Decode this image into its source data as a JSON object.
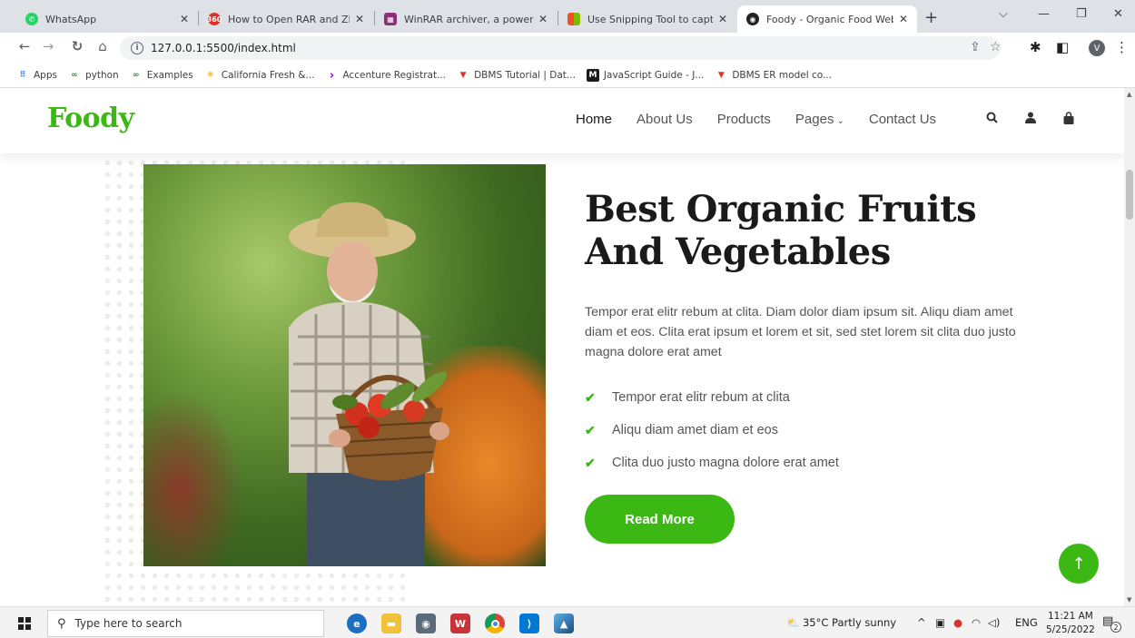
{
  "browser": {
    "tabs": [
      {
        "title": "WhatsApp",
        "favicon": "whatsapp-icon",
        "color": "#25d366"
      },
      {
        "title": "How to Open RAR and ZIP Fi",
        "favicon": "360-icon",
        "color": "#d9342b"
      },
      {
        "title": "WinRAR archiver, a powerful",
        "favicon": "winrar-icon",
        "color": "#8b2f7a"
      },
      {
        "title": "Use Snipping Tool to capture",
        "favicon": "windows-icon",
        "color": "#f4b400"
      },
      {
        "title": "Foody - Organic Food Webs",
        "favicon": "globe-icon",
        "color": "#202124"
      }
    ],
    "new_tab": "+",
    "url": "127.0.0.1:5500/index.html",
    "profile_initial": "V",
    "bookmarks": [
      {
        "label": "Apps",
        "icon": "apps-grid-icon"
      },
      {
        "label": "python",
        "icon": "gfg-icon"
      },
      {
        "label": "Examples",
        "icon": "gfg-icon"
      },
      {
        "label": "California Fresh &...",
        "icon": "sun-icon"
      },
      {
        "label": "Accenture Registrat...",
        "icon": "accenture-icon"
      },
      {
        "label": "DBMS Tutorial | Dat...",
        "icon": "javatpoint-icon"
      },
      {
        "label": "JavaScript Guide - J...",
        "icon": "mdn-icon"
      },
      {
        "label": "DBMS ER model co...",
        "icon": "javatpoint-icon"
      }
    ]
  },
  "site": {
    "logo": "Foody",
    "menu": [
      {
        "label": "Home",
        "active": true
      },
      {
        "label": "About Us",
        "active": false
      },
      {
        "label": "Products",
        "active": false
      },
      {
        "label": "Pages",
        "active": false,
        "dropdown": true
      },
      {
        "label": "Contact Us",
        "active": false
      }
    ],
    "hero": {
      "title_line1": "Best Organic Fruits",
      "title_line2": "And Vegetables",
      "paragraph": "Tempor erat elitr rebum at clita. Diam dolor diam ipsum sit. Aliqu diam amet diam et eos. Clita erat ipsum et lorem et sit, sed stet lorem sit clita duo justo magna dolore erat amet",
      "checklist": [
        "Tempor erat elitr rebum at clita",
        "Aliqu diam amet diam et eos",
        "Clita duo justo magna dolore erat amet"
      ],
      "button": "Read More"
    },
    "accent_color": "#3cb815"
  },
  "taskbar": {
    "search_placeholder": "Type here to search",
    "weather": "35°C  Partly sunny",
    "language": "ENG",
    "time": "11:21 AM",
    "date": "5/25/2022",
    "notification_count": "2"
  }
}
